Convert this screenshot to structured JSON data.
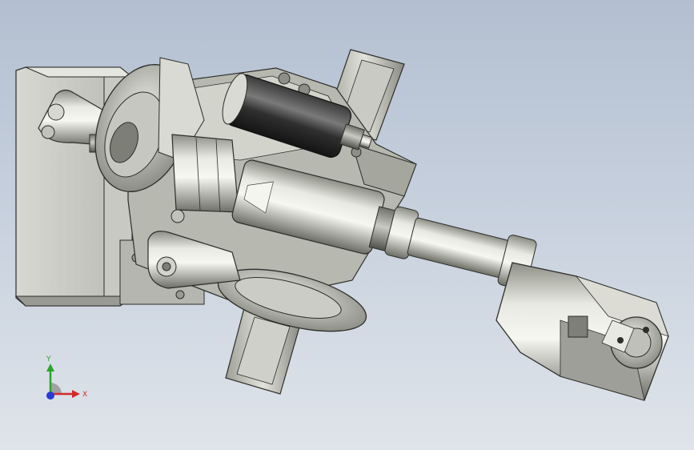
{
  "viewport": {
    "model_name": "robot-arm-assembly",
    "background_top": "#b3bfd0",
    "background_bottom": "#dfe4ea"
  },
  "triad": {
    "x_label": "X",
    "y_label": "Y",
    "x_color": "#d42a2a",
    "y_color": "#2aa52a",
    "z_color": "#2a3ad4"
  }
}
